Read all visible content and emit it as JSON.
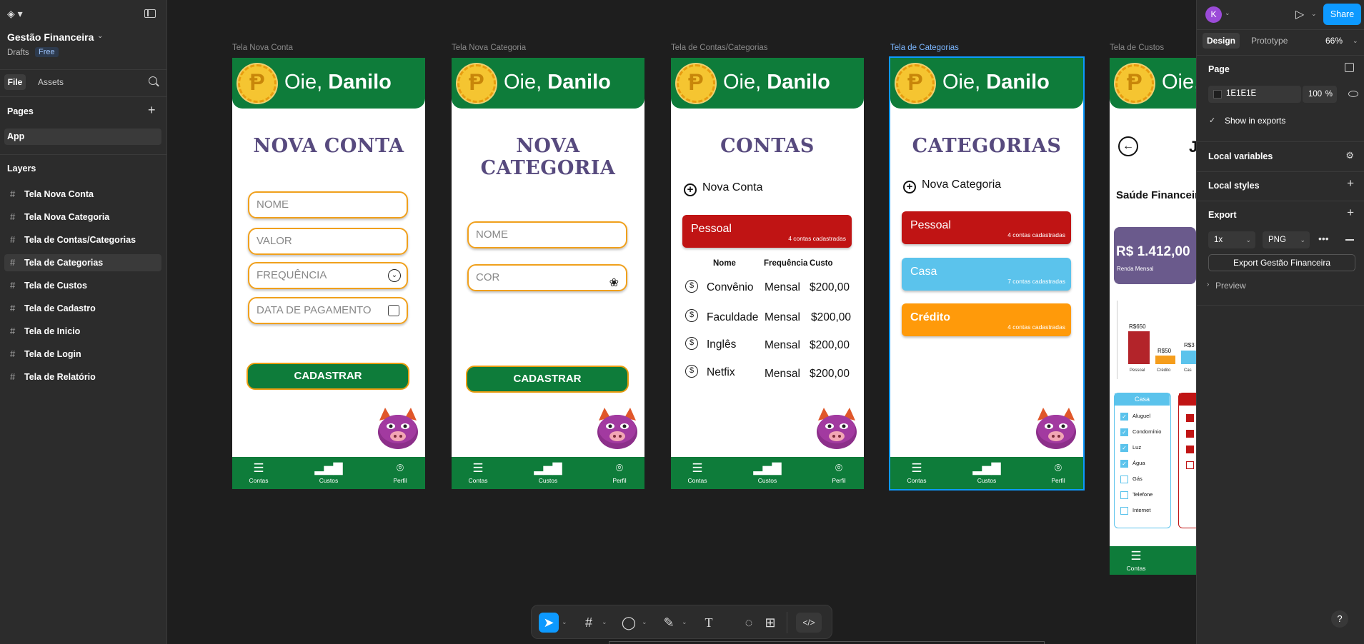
{
  "app": {
    "file_title": "Gestão Financeira",
    "drafts": "Drafts",
    "plan_badge": "Free"
  },
  "left_panel": {
    "tab_file": "File",
    "tab_assets": "Assets",
    "pages_title": "Pages",
    "current_page": "App",
    "layers_title": "Layers",
    "layers": [
      "Tela Nova Conta",
      "Tela Nova Categoria",
      "Tela de Contas/Categorias",
      "Tela de Categorias",
      "Tela de Custos",
      "Tela de Cadastro",
      "Tela de Inicio",
      "Tela de Login",
      "Tela de Relatório"
    ],
    "selected_layer": "Tela de Categorias"
  },
  "right_panel": {
    "avatar_letter": "K",
    "share": "Share",
    "tab_design": "Design",
    "tab_prototype": "Prototype",
    "zoom": "66%",
    "page_section": "Page",
    "page_color": "1E1E1E",
    "page_opacity": "100",
    "percent": "%",
    "show_in_exports": "Show in exports",
    "local_variables": "Local variables",
    "local_styles": "Local styles",
    "export": "Export",
    "export_scale": "1x",
    "export_format": "PNG",
    "export_button": "Export Gestão Financeira",
    "preview": "Preview"
  },
  "common": {
    "coin_symbol": "Ᵽ",
    "greeting": "Oie,",
    "user_name": "Danilo",
    "nav_contas": "Contas",
    "nav_custos": "Custos",
    "nav_perfil": "Perfil",
    "btn_cadastrar": "CADASTRAR"
  },
  "frames": {
    "nova_conta": {
      "label": "Tela Nova Conta",
      "title": "NOVA CONTA",
      "nome": "NOME",
      "valor": "VALOR",
      "frequencia": "FREQUÊNCIA",
      "data": "DATA DE PAGAMENTO"
    },
    "nova_categoria": {
      "label": "Tela Nova Categoria",
      "title": "NOVA CATEGORIA",
      "nome": "NOME",
      "cor": "COR"
    },
    "contas": {
      "label": "Tela de Contas/Categorias",
      "title": "CONTAS",
      "add": "Nova Conta",
      "card_title": "Pessoal",
      "card_sub": "4 contas cadastradas",
      "headers": [
        "Nome",
        "Frequência",
        "Custo"
      ],
      "rows": [
        {
          "nome": "Convênio",
          "freq": "Mensal",
          "custo": "$200,00"
        },
        {
          "nome": "Faculdade",
          "freq": "Mensal",
          "custo": "$200,00"
        },
        {
          "nome": "Inglês",
          "freq": "Mensal",
          "custo": "$200,00"
        },
        {
          "nome": "Netfix",
          "freq": "Mensal",
          "custo": "$200,00"
        }
      ]
    },
    "categorias": {
      "label": "Tela de Categorias",
      "title": "CATEGORIAS",
      "add": "Nova Categoria",
      "cards": [
        {
          "title": "Pessoal",
          "sub": "4 contas cadastradas",
          "color": "#c01414"
        },
        {
          "title": "Casa",
          "sub": "7 contas cadastradas",
          "color": "#5bc3ec"
        },
        {
          "title": "Crédito",
          "sub": "4 contas cadastradas",
          "color": "#ff9a0a"
        }
      ]
    },
    "custos": {
      "label": "Tela de Custos",
      "greeting_partial": "Oie,",
      "header_initial": "J",
      "saude": "Saúde Financeir",
      "renda_value": "R$ 1.412,00",
      "renda_label": "Renda Mensal",
      "bars": [
        {
          "label": "R$650",
          "name": "Pessoal"
        },
        {
          "label": "R$50",
          "name": "Crédito"
        },
        {
          "label": "R$3",
          "name": "Cas"
        }
      ],
      "casa_title": "Casa",
      "checklist": [
        {
          "name": "Aluguel",
          "checked": true
        },
        {
          "name": "Condomínio",
          "checked": true
        },
        {
          "name": "Luz",
          "checked": true
        },
        {
          "name": "Água",
          "checked": true
        },
        {
          "name": "Gás",
          "checked": false
        },
        {
          "name": "Telefone",
          "checked": false
        },
        {
          "name": "Internet",
          "checked": false
        }
      ],
      "nav_contas": "Contas"
    }
  },
  "colors": {
    "brand_green": "#0e7c3a",
    "title_purple": "#574a7e",
    "accent_orange": "#f0a01c",
    "figma_blue": "#0d99ff"
  }
}
